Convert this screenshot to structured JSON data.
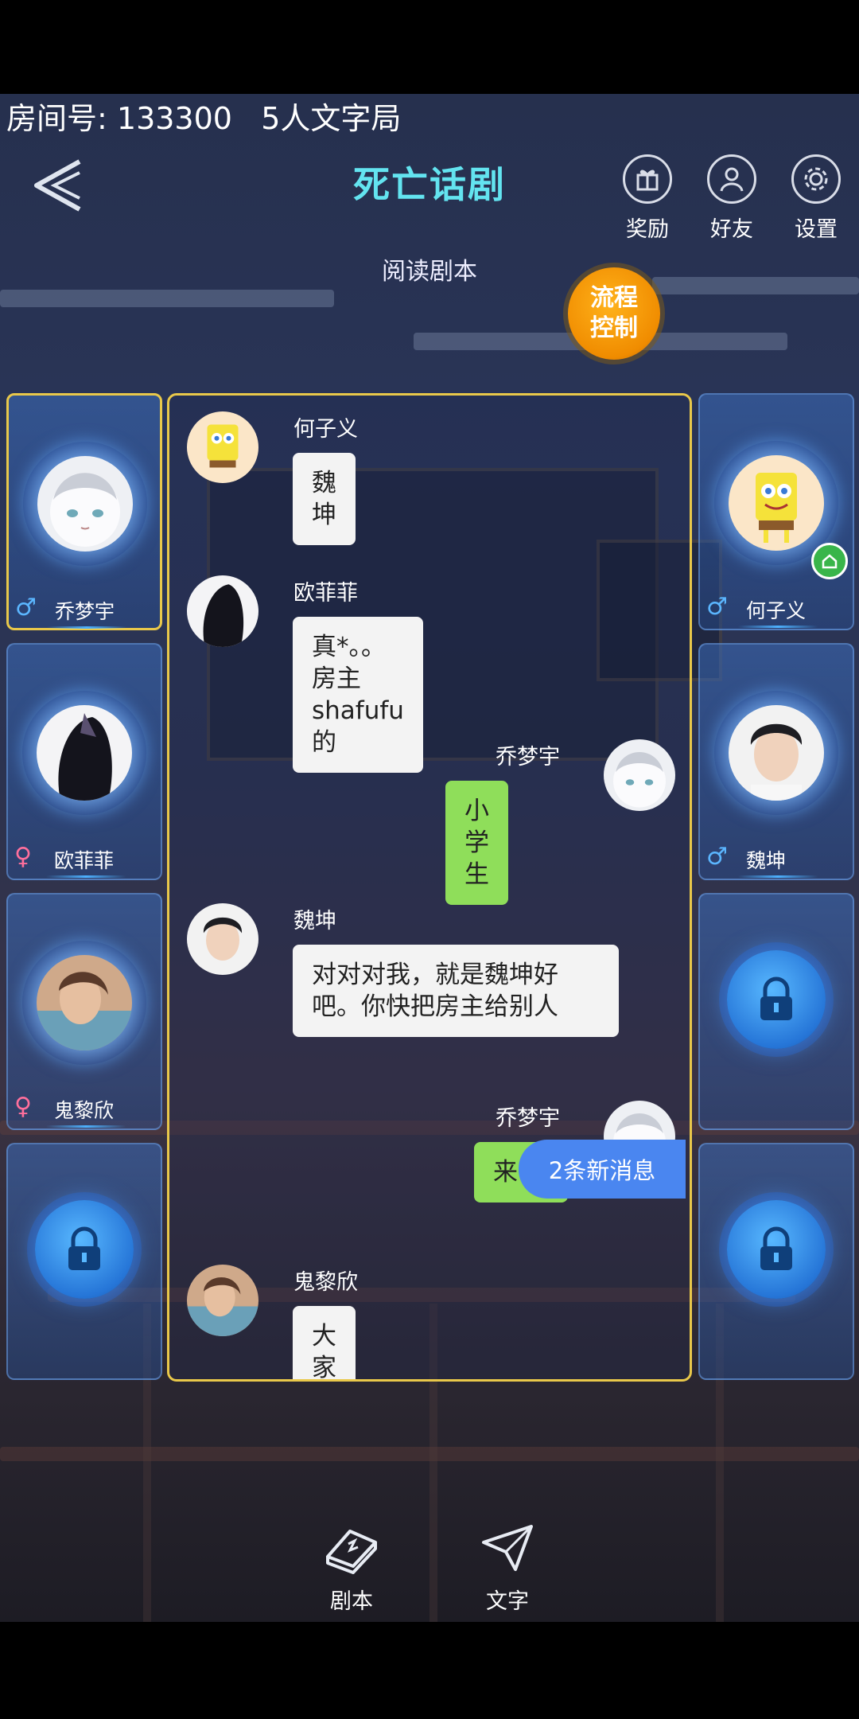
{
  "room": {
    "label": "房间号:",
    "number": "133300",
    "mode": "5人文字局"
  },
  "header": {
    "title": "死亡话剧",
    "subtitle": "阅读剧本",
    "icons": [
      {
        "name": "gift-icon",
        "label": "奖励"
      },
      {
        "name": "friends-icon",
        "label": "好友"
      },
      {
        "name": "gear-icon",
        "label": "设置"
      }
    ],
    "flow_button": {
      "line1": "流程",
      "line2": "控制"
    }
  },
  "players_left": [
    {
      "name": "乔梦宇",
      "gender": "♂",
      "active": true
    },
    {
      "name": "欧菲菲",
      "gender": "♀"
    },
    {
      "name": "鬼黎欣",
      "gender": "♀"
    },
    {
      "locked": true
    }
  ],
  "players_right": [
    {
      "name": "何子义",
      "gender": "♂",
      "host": true
    },
    {
      "name": "魏坤",
      "gender": "♂"
    },
    {
      "locked": true
    },
    {
      "locked": true
    }
  ],
  "messages": [
    {
      "sender": "何子义",
      "text": "魏坤",
      "side": "left"
    },
    {
      "sender": "欧菲菲",
      "text": "真*。。房主shafufu的",
      "side": "left"
    },
    {
      "sender": "乔梦宇",
      "text": "小学生",
      "side": "right"
    },
    {
      "sender": "魏坤",
      "text": "对对对我，就是魏坤好吧。你快把房主给别人",
      "side": "left"
    },
    {
      "sender": "乔梦宇",
      "text": "来",
      "side": "right"
    },
    {
      "sender": "鬼黎欣",
      "text": "大家撤吗",
      "side": "left"
    }
  ],
  "new_messages_label": "2条新消息",
  "bottom_tabs": [
    {
      "icon": "book-icon",
      "label": "剧本"
    },
    {
      "icon": "paper-plane-icon",
      "label": "文字"
    }
  ],
  "colors": {
    "accent_title": "#63e4f0",
    "panel_border": "#e9c84a",
    "bubble_green": "#8fde5a",
    "new_msg_blue": "#4a86f0"
  }
}
